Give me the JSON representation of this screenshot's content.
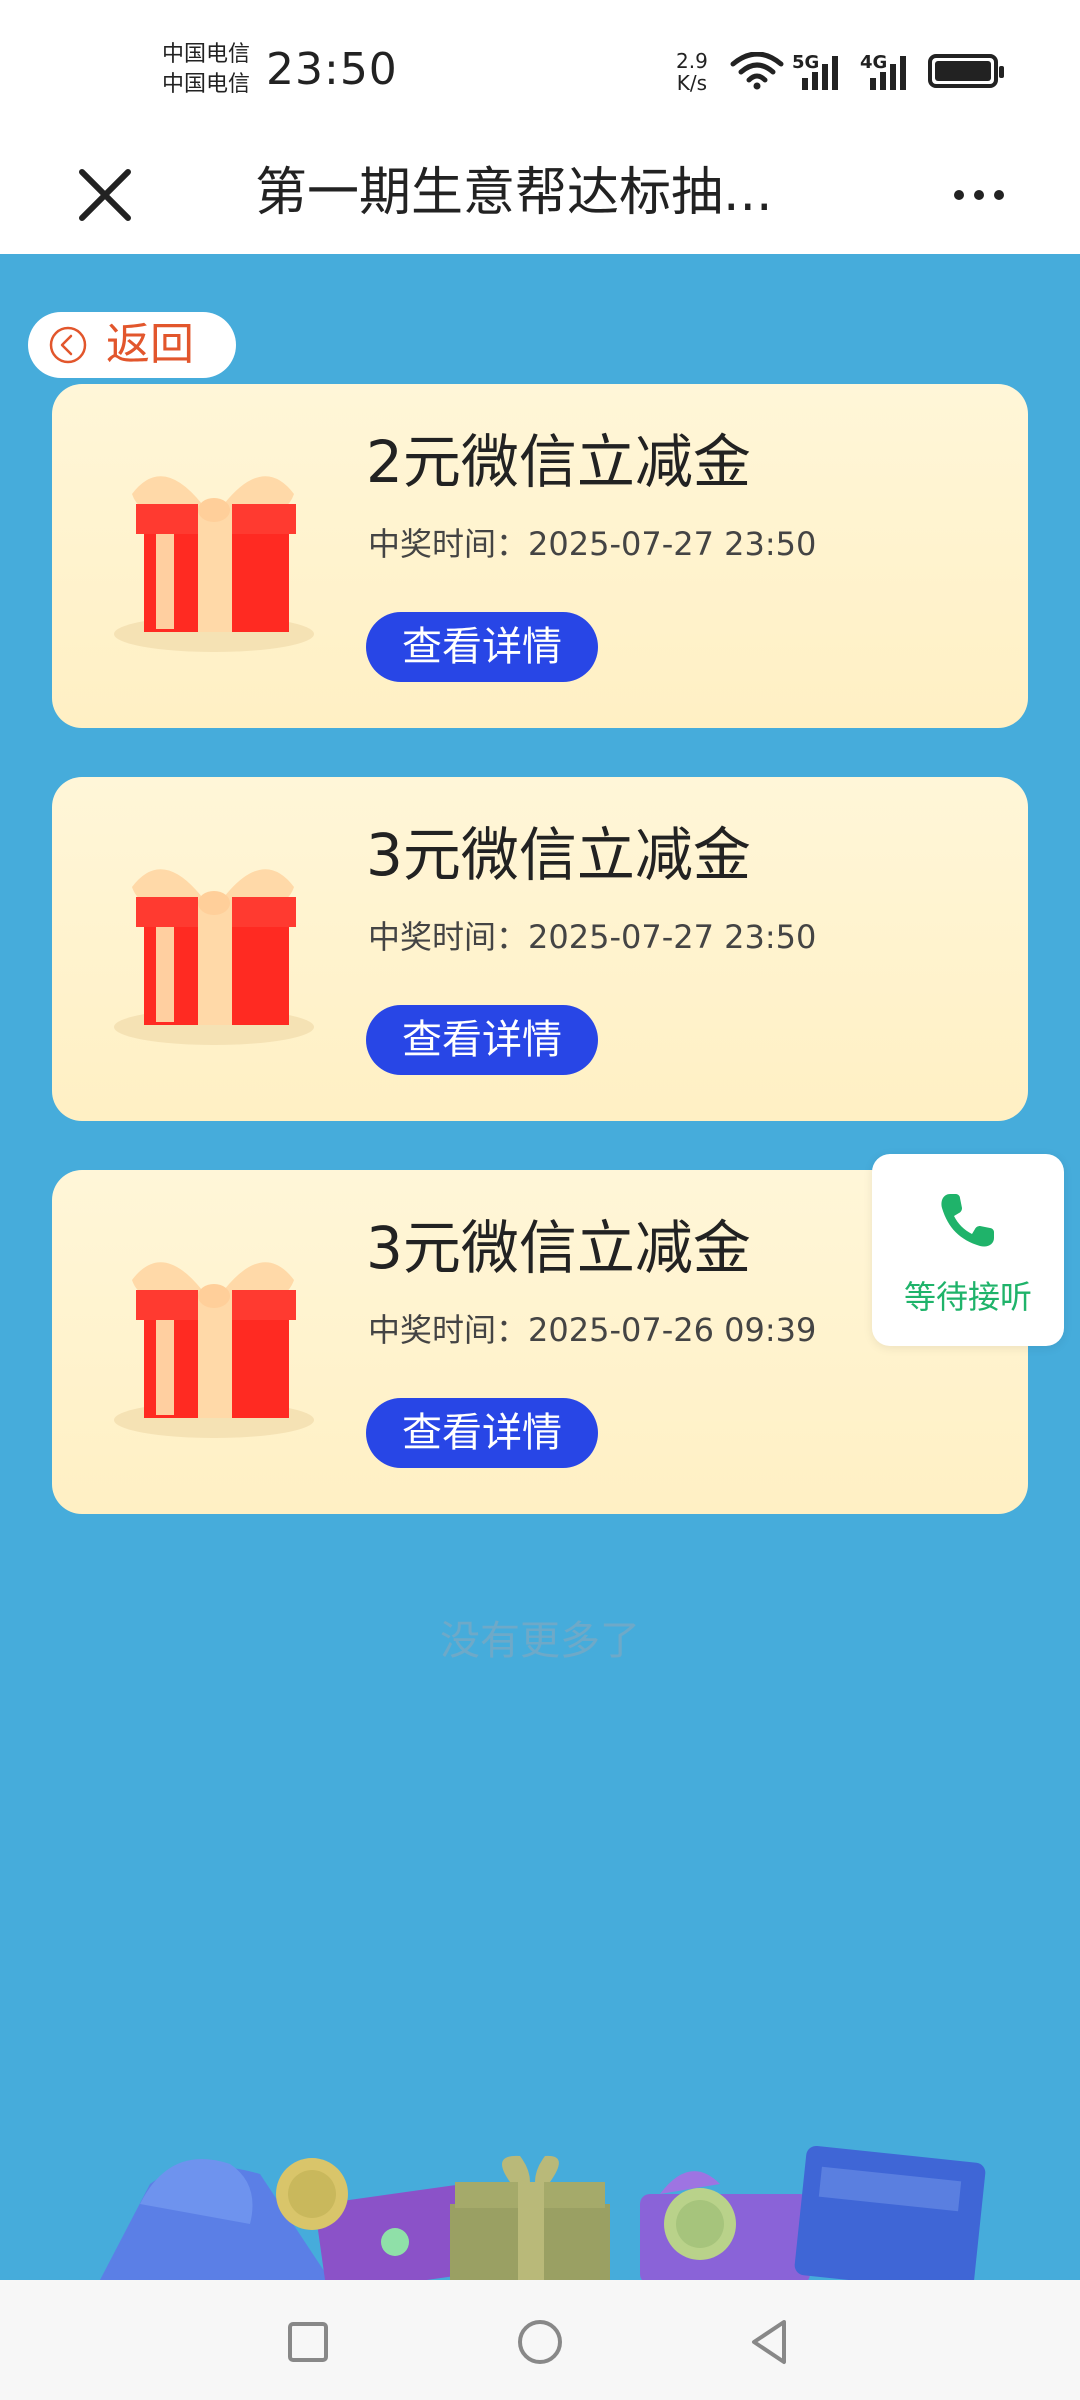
{
  "status_bar": {
    "carrier_1": "中国电信",
    "carrier_2": "中国电信",
    "time": "23:50",
    "net_speed_value": "2.9",
    "net_speed_unit": "K/s",
    "network_1": "5G",
    "network_2": "4G"
  },
  "nav": {
    "title": "第一期生意帮达标抽..."
  },
  "back": {
    "label": "返回"
  },
  "prizes": [
    {
      "title": "2元微信立减金",
      "time_label": "中奖时间：",
      "time": "2025-07-27 23:50",
      "button": "查看详情"
    },
    {
      "title": "3元微信立减金",
      "time_label": "中奖时间：",
      "time": "2025-07-27 23:50",
      "button": "查看详情"
    },
    {
      "title": "3元微信立减金",
      "time_label": "中奖时间：",
      "time": "2025-07-26 09:39",
      "button": "查看详情"
    }
  ],
  "float_call": {
    "label": "等待接听"
  },
  "list_end_text": "没有更多了",
  "colors": {
    "background": "#46acdb",
    "card": "#fff3cf",
    "button": "#2846e6",
    "back_text": "#e2562c",
    "call_green": "#1fb36a"
  },
  "icons": {
    "close": "close-icon",
    "more": "more-icon",
    "back": "back-circle-icon",
    "gift": "gift-box-icon",
    "phone": "phone-icon"
  }
}
